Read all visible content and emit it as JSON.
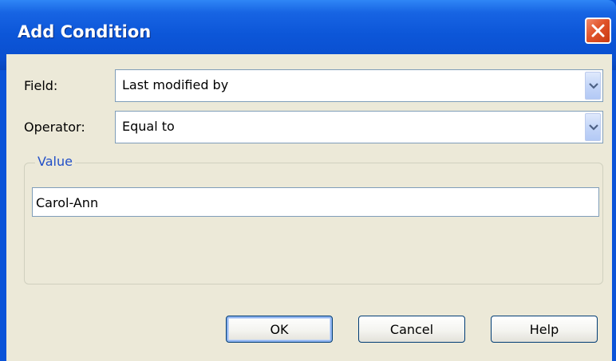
{
  "dialog": {
    "title": "Add Condition"
  },
  "form": {
    "field_label": "Field:",
    "field_value": "Last modified by",
    "operator_label": "Operator:",
    "operator_value": "Equal to",
    "value_group_label": "Value",
    "value_input": "Carol-Ann"
  },
  "buttons": {
    "ok": "OK",
    "cancel": "Cancel",
    "help": "Help"
  },
  "icons": {
    "close": "close-icon",
    "dropdown": "chevron-down-icon"
  },
  "colors": {
    "titlebar": "#0a53d8",
    "client_background": "#ece9d8",
    "close_button": "#e0532a",
    "group_label": "#2250c8"
  }
}
